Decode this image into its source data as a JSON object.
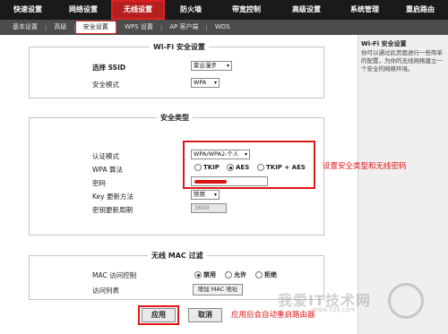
{
  "top_nav": [
    "快速设置",
    "网络设置",
    "无线设置",
    "防火墙",
    "带宽控制",
    "高级设置",
    "系统管理",
    "重启路由"
  ],
  "sub_nav": [
    "基本设置",
    "高级",
    "安全设置",
    "WPS 设置",
    "AP 客户端",
    "WDS"
  ],
  "sidebar": {
    "title": "Wi-Fi 安全设置",
    "body": "你可以通过此页面进行一些简单的配置，为你的无线网络建立一个安全的网络环境。"
  },
  "wifi": {
    "title": "Wi-Fi 安全设置",
    "ssid_label": "选择 SSID",
    "ssid_value": "紫云漫步",
    "mode_label": "安全模式",
    "mode_value": "WPA"
  },
  "security": {
    "title": "安全类型",
    "auth_label": "认证模式",
    "auth_value": "WPA/WPA2-个人",
    "algo_label": "WPA 算法",
    "algo_tkip": "TKIP",
    "algo_aes": "AES",
    "algo_both": "TKIP + AES",
    "pwd_label": "密码",
    "key_update_label": "Key 更新方法",
    "key_update_value": "禁用",
    "key_period_label": "密钥更新周期",
    "key_period_value": "3600"
  },
  "mac": {
    "title": "无线 MAC 过滤",
    "access_label": "MAC 访问控制",
    "opt_disable": "禁用",
    "opt_allow": "允许",
    "opt_deny": "拒绝",
    "list_label": "访问列表",
    "add_button": "增加 MAC 地址"
  },
  "actions": {
    "apply": "应用",
    "cancel": "取消"
  },
  "annotations": {
    "security": "设置安全类型和无线密码",
    "apply": "应用后会自动重启路由器"
  },
  "watermark": {
    "main": "我爱IT技术网",
    "sub": "www.52ij.com"
  }
}
